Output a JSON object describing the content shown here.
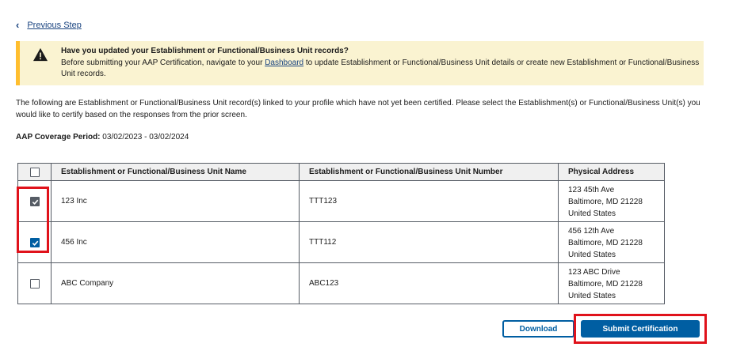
{
  "nav": {
    "back_chevron": "‹",
    "previous_step": "Previous Step"
  },
  "alert": {
    "icon": "warning-icon",
    "title": "Have you updated your Establishment or Functional/Business Unit records?",
    "body_before_link": "Before submitting your AAP Certification, navigate to your ",
    "link_text": "Dashboard",
    "body_after_link": " to update Establishment or Functional/Business Unit details or create new Establishment or Functional/Business Unit records.",
    "background_color": "#faf3d1"
  },
  "intro_text": "The following are Establishment or Functional/Business Unit record(s) linked to your profile which have not yet been certified. Please select the Establishment(s) or Functional/Business Unit(s) you would like to certify based on the responses from the prior screen.",
  "coverage": {
    "label": "AAP Coverage Period:",
    "value": "03/02/2023 - 03/02/2024"
  },
  "table": {
    "headers": {
      "name": "Establishment or Functional/Business Unit Name",
      "number": "Establishment or Functional/Business Unit Number",
      "address": "Physical Address"
    },
    "select_all_checked": false,
    "rows": [
      {
        "checked": true,
        "name": "123 Inc",
        "number": "TTT123",
        "address_line1": "123 45th Ave",
        "address_line2": "Baltimore, MD 21228",
        "address_line3": "United States"
      },
      {
        "checked": true,
        "name": "456 Inc",
        "number": "TTT112",
        "address_line1": "456 12th Ave",
        "address_line2": "Baltimore, MD 21228",
        "address_line3": "United States"
      },
      {
        "checked": false,
        "name": "ABC Company",
        "number": "ABC123",
        "address_line1": "123 ABC Drive",
        "address_line2": "Baltimore, MD 21228",
        "address_line3": "United States"
      }
    ]
  },
  "actions": {
    "download": "Download",
    "submit": "Submit Certification"
  },
  "colors": {
    "primary": "#005ea2",
    "highlight": "#e0121b",
    "link": "#1a4480"
  }
}
